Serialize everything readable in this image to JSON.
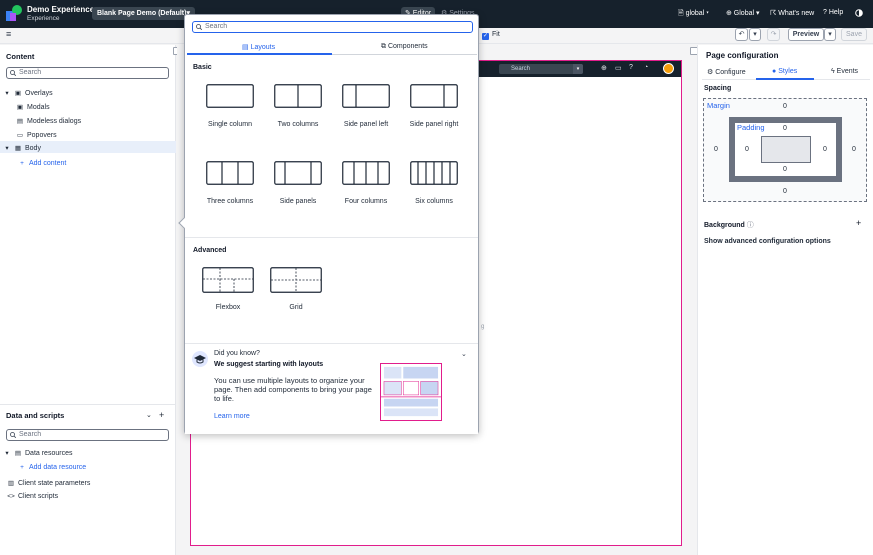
{
  "header": {
    "app_name": "Demo Experience",
    "app_sub": "Experience",
    "page_pill": "Blank Page Demo (Default)▾",
    "editor_tab": "✎ Editor",
    "settings_tab": "⚙ Settings",
    "scope": "🗎 global ▾",
    "global_menu": "⊕ Global ▾",
    "whats_new": "☈ What's new",
    "help": "? Help",
    "contrast_icon": "contrast-icon"
  },
  "toolbar": {
    "fit_label": "Fit",
    "fit_checked": true,
    "preview_label": "Preview",
    "save_label": "Save"
  },
  "content_panel": {
    "title": "Content",
    "search_placeholder": "Search",
    "items": {
      "overlays": "Overlays",
      "modals": "Modals",
      "modeless": "Modeless dialogs",
      "popovers": "Popovers",
      "body": "Body",
      "add_content": "Add content"
    }
  },
  "data_panel": {
    "title": "Data and scripts",
    "search_placeholder": "Search",
    "items": {
      "data_resources": "Data resources",
      "add_data_resource": "Add data resource",
      "client_state": "Client state parameters",
      "client_scripts": "Client scripts"
    }
  },
  "canvas": {
    "search_placeholder": "Search",
    "stray_text": "g"
  },
  "popover": {
    "search_placeholder": "Search",
    "tabs": {
      "layouts": "Layouts",
      "components": "Components"
    },
    "basic_label": "Basic",
    "advanced_label": "Advanced",
    "layouts": {
      "single_column": "Single column",
      "two_columns": "Two columns",
      "side_panel_left": "Side panel left",
      "side_panel_right": "Side panel right",
      "three_columns": "Three columns",
      "side_panels": "Side panels",
      "four_columns": "Four columns",
      "six_columns": "Six columns",
      "flexbox": "Flexbox",
      "grid": "Grid"
    },
    "tip": {
      "title": "Did you know?",
      "subtitle": "We suggest starting with layouts",
      "body": "You can use multiple layouts to organize your page. Then add components to bring your page to life.",
      "link": "Learn more"
    }
  },
  "config_panel": {
    "title": "Page configuration",
    "tabs": {
      "configure": "Configure",
      "styles": "Styles",
      "events": "Events"
    },
    "spacing_label": "Spacing",
    "margin_label": "Margin",
    "padding_label": "Padding",
    "margin": {
      "top": "0",
      "right": "0",
      "bottom": "0",
      "left": "0"
    },
    "padding": {
      "top": "0",
      "right": "0",
      "bottom": "0",
      "left": "0"
    },
    "background_label": "Background",
    "advanced_link": "Show advanced configuration options"
  },
  "colors": {
    "accent": "#2563eb",
    "header_bg": "#16212c",
    "canvas_border": "#e11d8c"
  }
}
